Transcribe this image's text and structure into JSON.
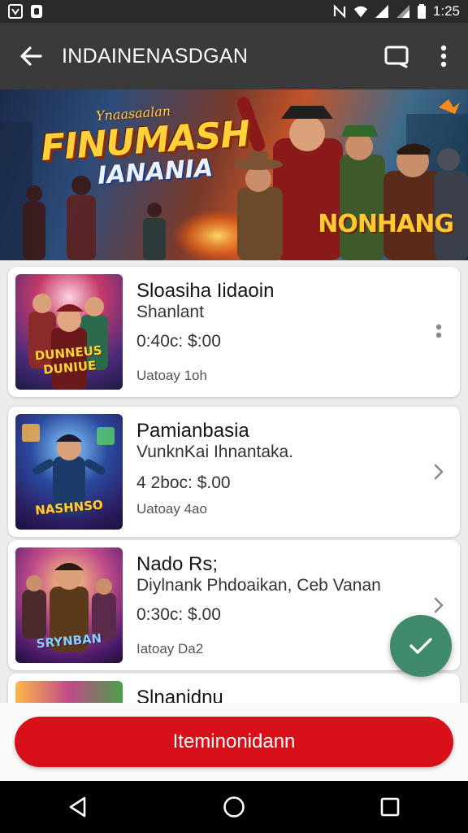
{
  "status_bar": {
    "time": "1:25"
  },
  "app_bar": {
    "title": "INDAINENASDGAN"
  },
  "hero": {
    "top_text": "Ynaasaalan",
    "title": "FINUMASH",
    "subtitle": "IANANIA",
    "badge": "NONHANG"
  },
  "items": [
    {
      "title": "Sloasiha Iidaoin",
      "subtitle": "Shanlant",
      "price": "0:40c: $:00",
      "date": "Uatoay 1oh",
      "thumb_label": "DUNNEUS DUNIUE",
      "action_icon": "more-vert-icon"
    },
    {
      "title": "Pamianbasia",
      "subtitle": "VunknKai Ihnantaka.",
      "price": "4 2boc: $.00",
      "date": "Uatoay 4ao",
      "thumb_label": "NASHNSO",
      "action_icon": "chevron-right-icon"
    },
    {
      "title": "Nado Rs;",
      "subtitle": "Diylnank Phdoaikan, Ceb Vanan",
      "price": "0:30c: $.00",
      "date": "Iatoay Da2",
      "thumb_label": "SRYNBAN",
      "action_icon": "chevron-right-icon"
    },
    {
      "title": "Slnanidnu",
      "subtitle": "",
      "price": "",
      "date": "",
      "thumb_label": "",
      "action_icon": ""
    }
  ],
  "cta": {
    "label": "Iteminonidann"
  },
  "colors": {
    "accent": "#d8101a",
    "fab": "#3f8a6a",
    "app_bar": "#3a3a3a"
  }
}
